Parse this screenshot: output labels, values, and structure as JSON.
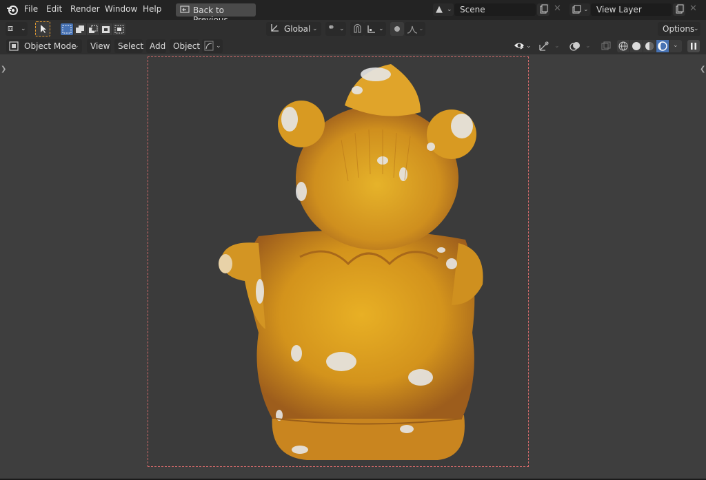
{
  "topbar": {
    "menus": [
      "File",
      "Edit",
      "Render",
      "Window",
      "Help"
    ],
    "back_button": "Back to Previous",
    "scene": {
      "value": "Scene"
    },
    "view_layer": {
      "value": "View Layer"
    }
  },
  "header": {
    "orientation": "Global",
    "options": "Options",
    "mode": "Object Mode",
    "menus": [
      "View",
      "Select",
      "Add",
      "Object"
    ]
  },
  "colors": {
    "accent_blue": "#4772b3",
    "frame_border": "#d46a6a",
    "viewport_bg": "#3e3e3e",
    "active_tool": "#e09a33"
  },
  "viewport": {
    "content": "orange bear figurine, rear view"
  }
}
